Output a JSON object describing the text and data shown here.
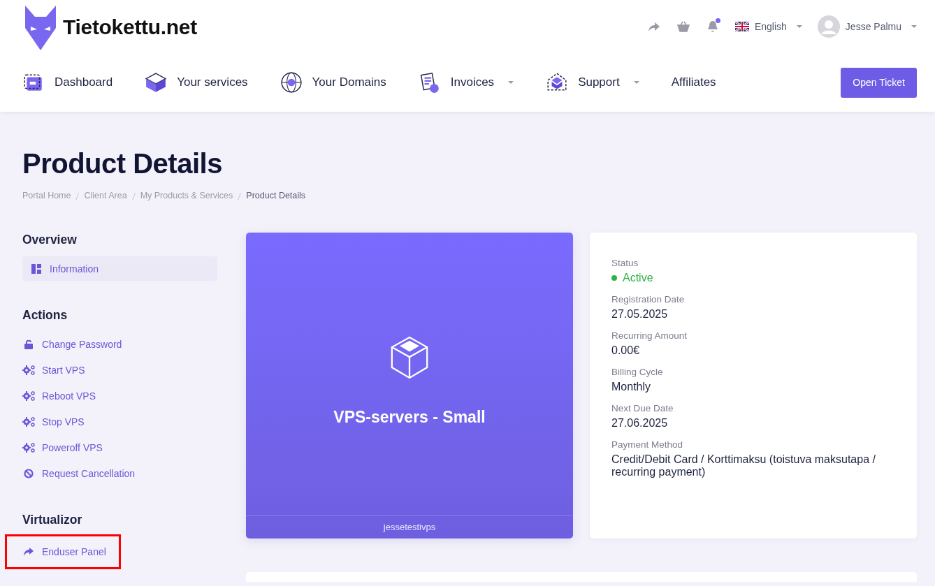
{
  "header": {
    "logo_text": "Tietokettu.net",
    "language": "English",
    "user_name": "Jesse Palmu",
    "notification_dot": true
  },
  "nav": [
    {
      "label": "Dashboard",
      "dropdown": false
    },
    {
      "label": "Your services",
      "dropdown": false
    },
    {
      "label": "Your Domains",
      "dropdown": false
    },
    {
      "label": "Invoices",
      "dropdown": true
    },
    {
      "label": "Support",
      "dropdown": true
    },
    {
      "label": "Affiliates",
      "dropdown": false
    }
  ],
  "nav_button": "Open Ticket",
  "page_title": "Product Details",
  "breadcrumb": [
    {
      "label": "Portal Home",
      "current": false
    },
    {
      "label": "Client Area",
      "current": false
    },
    {
      "label": "My Products & Services",
      "current": false
    },
    {
      "label": "Product Details",
      "current": true
    }
  ],
  "sidebar": [
    {
      "heading": "Overview",
      "items": [
        {
          "label": "Information",
          "selected": true,
          "highlighted": false
        }
      ]
    },
    {
      "heading": "Actions",
      "items": [
        {
          "label": "Change Password",
          "selected": false,
          "highlighted": false
        },
        {
          "label": "Start VPS",
          "selected": false,
          "highlighted": false
        },
        {
          "label": "Reboot VPS",
          "selected": false,
          "highlighted": false
        },
        {
          "label": "Stop VPS",
          "selected": false,
          "highlighted": false
        },
        {
          "label": "Poweroff VPS",
          "selected": false,
          "highlighted": false
        },
        {
          "label": "Request Cancellation",
          "selected": false,
          "highlighted": false
        }
      ]
    },
    {
      "heading": "Virtualizor",
      "items": [
        {
          "label": "Enduser Panel",
          "selected": false,
          "highlighted": true
        }
      ]
    }
  ],
  "product_card": {
    "name": "VPS-servers - Small",
    "hostname": "jessetestivps"
  },
  "details": [
    {
      "label": "Status",
      "value": "Active",
      "kind": "status",
      "color": "#2fb344"
    },
    {
      "label": "Registration Date",
      "value": "27.05.2025",
      "kind": "text"
    },
    {
      "label": "Recurring Amount",
      "value": "0.00€",
      "kind": "text"
    },
    {
      "label": "Billing Cycle",
      "value": "Monthly",
      "kind": "text"
    },
    {
      "label": "Next Due Date",
      "value": "27.06.2025",
      "kind": "text"
    },
    {
      "label": "Payment Method",
      "value": "Credit/Debit Card / Korttimaksu (toistuva maksutapa / recurring payment)",
      "kind": "text"
    }
  ]
}
